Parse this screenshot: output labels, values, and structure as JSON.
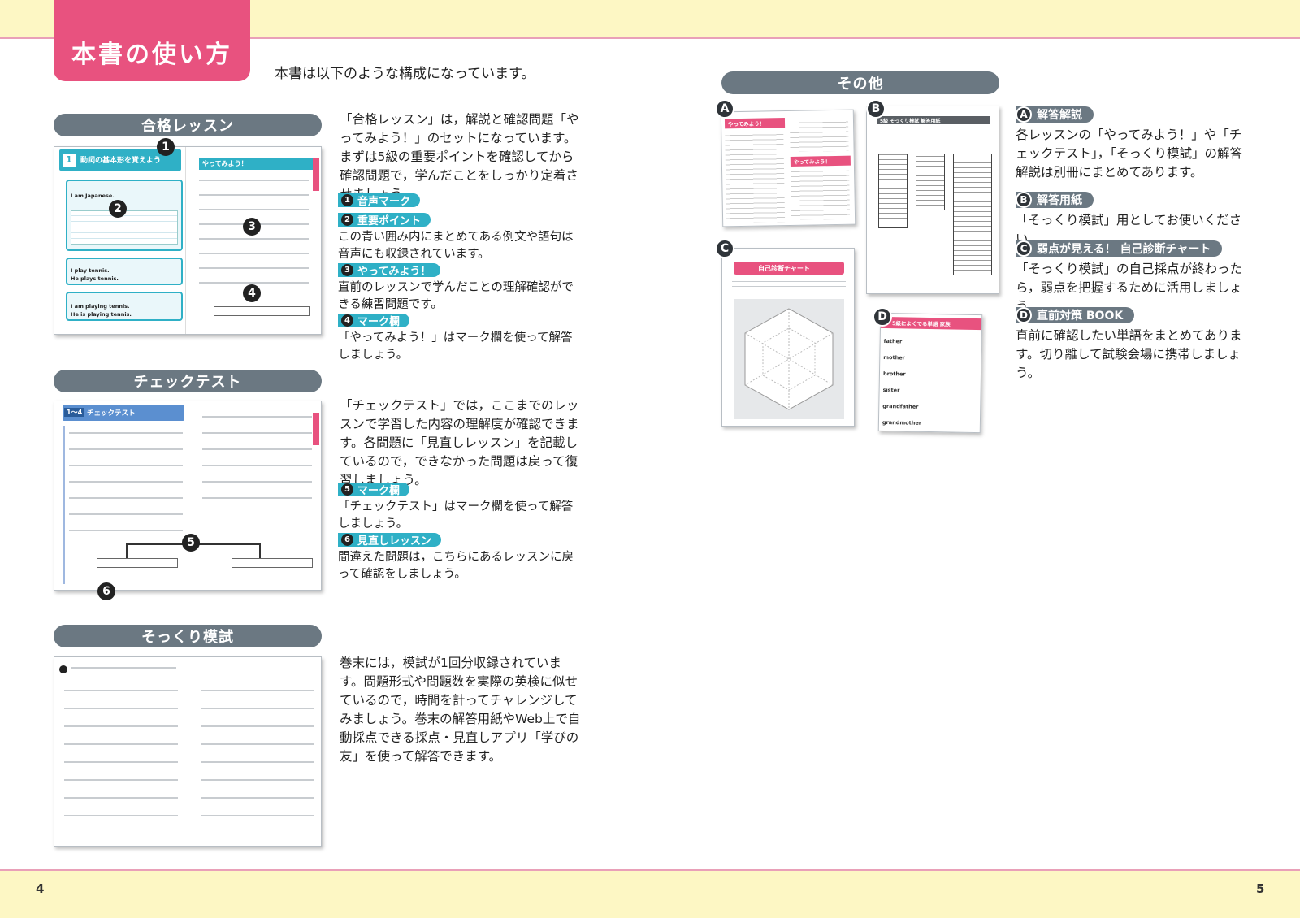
{
  "header": {
    "title": "本書の使い方",
    "intro": "本書は以下のような構成になっています。"
  },
  "sections": {
    "lesson": {
      "title": "合格レッスン",
      "desc": "「合格レッスン」は，解説と確認問題「やってみよう！」のセットになっています。まずは5級の重要ポイントを確認してから確認問題で，学んだことをしっかり定着させましょう。",
      "items": [
        {
          "num": "1",
          "label": "音声マーク",
          "text": ""
        },
        {
          "num": "2",
          "label": "重要ポイント",
          "text": "この青い囲み内にまとめてある例文や語句は音声にも収録されています。"
        },
        {
          "num": "3",
          "label": "やってみよう！",
          "text": "直前のレッスンで学んだことの理解確認ができる練習問題です。"
        },
        {
          "num": "4",
          "label": "マーク欄",
          "text": "「やってみよう！」はマーク欄を使って解答しましょう。"
        }
      ],
      "thumb": {
        "lesson_no": "1",
        "heading": "動詞の基本形を覚えよう",
        "right_head": "やってみよう！",
        "ex1": "I am Japanese.",
        "ex2": "I play tennis.",
        "ex3": "He plays tennis.",
        "ex4": "I am playing tennis.",
        "ex5": "He is playing tennis."
      }
    },
    "check": {
      "title": "チェックテスト",
      "desc": "「チェックテスト」では，ここまでのレッスンで学習した内容の理解度が確認できます。各問題に「見直しレッスン」を記載しているので，できなかった問題は戻って復習しましょう。",
      "items": [
        {
          "num": "5",
          "label": "マーク欄",
          "text": "「チェックテスト」はマーク欄を使って解答しましょう。"
        },
        {
          "num": "6",
          "label": "見直しレッスン",
          "text": "間違えた問題は，こちらにあるレッスンに戻って確認をしましょう。"
        }
      ],
      "thumb": {
        "range": "1～4",
        "heading": "チェックテスト"
      }
    },
    "mock": {
      "title": "そっくり模試",
      "desc": "巻末には，模試が1回分収録されています。問題形式や問題数を実際の英検に似せているので，時間を計ってチャレンジしてみましょう。巻末の解答用紙やWeb上で自動採点できる採点・見直しアプリ「学びの友」を使って解答できます。"
    },
    "other": {
      "title": "その他",
      "items": [
        {
          "letter": "A",
          "label": "解答解説",
          "text": "各レッスンの「やってみよう！」や「チェックテスト」，「そっくり模試」の解答解説は別冊にまとめてあります。"
        },
        {
          "letter": "B",
          "label": "解答用紙",
          "text": "「そっくり模試」用としてお使いください。"
        },
        {
          "letter": "C",
          "label": "弱点が見える！ 自己診断チャート",
          "text": "「そっくり模試」の自己採点が終わったら，弱点を把握するために活用しましょう。"
        },
        {
          "letter": "D",
          "label": "直前対策 BOOK",
          "text": "直前に確認したい単語をまとめてあります。切り離して試験会場に携帯しましょう。"
        }
      ],
      "thumbs": {
        "a_head1": "やってみよう！",
        "a_head2": "やってみよう！",
        "b_head": "5級 そっくり模試 解答用紙",
        "c_head": "自己診断チャート",
        "d_head": "5級によくでる単語 家族",
        "d_words": [
          "father",
          "mother",
          "brother",
          "sister",
          "grandfather",
          "grandmother"
        ]
      }
    }
  },
  "footer": {
    "left_page": "4",
    "right_page": "5"
  },
  "colors": {
    "accent": "#e8527f",
    "teal": "#2fb0c6",
    "pill": "#6b7882",
    "band": "#fdf7c4"
  }
}
